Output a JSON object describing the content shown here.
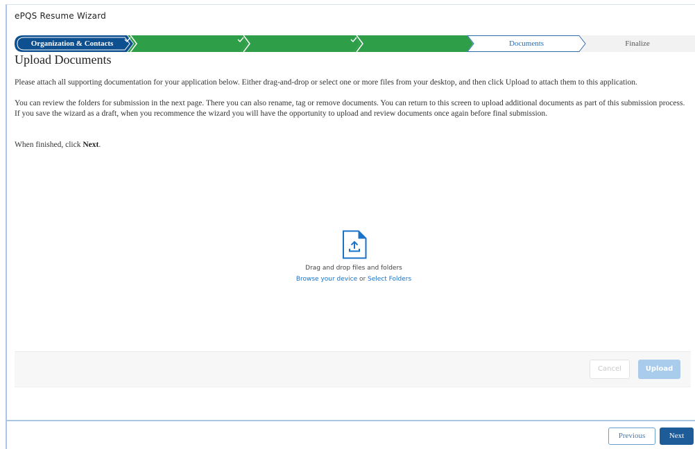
{
  "window": {
    "title": "ePQS Resume Wizard"
  },
  "steps": [
    {
      "label": "Organization & Contacts",
      "state": "active"
    },
    {
      "label": "",
      "state": "complete",
      "icon": "check-icon"
    },
    {
      "label": "",
      "state": "complete",
      "icon": "check-icon"
    },
    {
      "label": "",
      "state": "complete",
      "icon": "check-icon"
    },
    {
      "label": "Documents",
      "state": "current"
    },
    {
      "label": "Finalize",
      "state": "pending"
    }
  ],
  "page": {
    "title": "Upload Documents",
    "paragraph1": "Please attach all supporting documentation for your application below. Either drag-and-drop or select one or more files from your desktop, and then click Upload to attach them to this application.",
    "paragraph2": "You can review the folders for submission in the next page. There you can also rename, tag or remove documents. You can return to this screen to upload additional documents as part of this submission process. If you save the wizard as a draft, when you recommence the wizard you will have the opportunity to upload and review documents once again before final submission.",
    "finish_prefix": "When finished, click ",
    "finish_keyword": "Next",
    "finish_suffix": "."
  },
  "dropzone": {
    "icon": "file-upload-icon",
    "instruction": "Drag and drop files and folders",
    "browse_link": "Browse your device",
    "separator": " or ",
    "folders_link": "Select Folders"
  },
  "upload_bar": {
    "cancel_label": "Cancel",
    "upload_label": "Upload"
  },
  "footer": {
    "previous_label": "Previous",
    "next_label": "Next"
  },
  "colors": {
    "active_step": "#0e4f8f",
    "complete_step": "#2e9e48",
    "current_step_border": "#2b6cb0",
    "pending_step": "#f2f2f2",
    "link": "#1a73c8",
    "primary_button": "#1d5b99"
  }
}
